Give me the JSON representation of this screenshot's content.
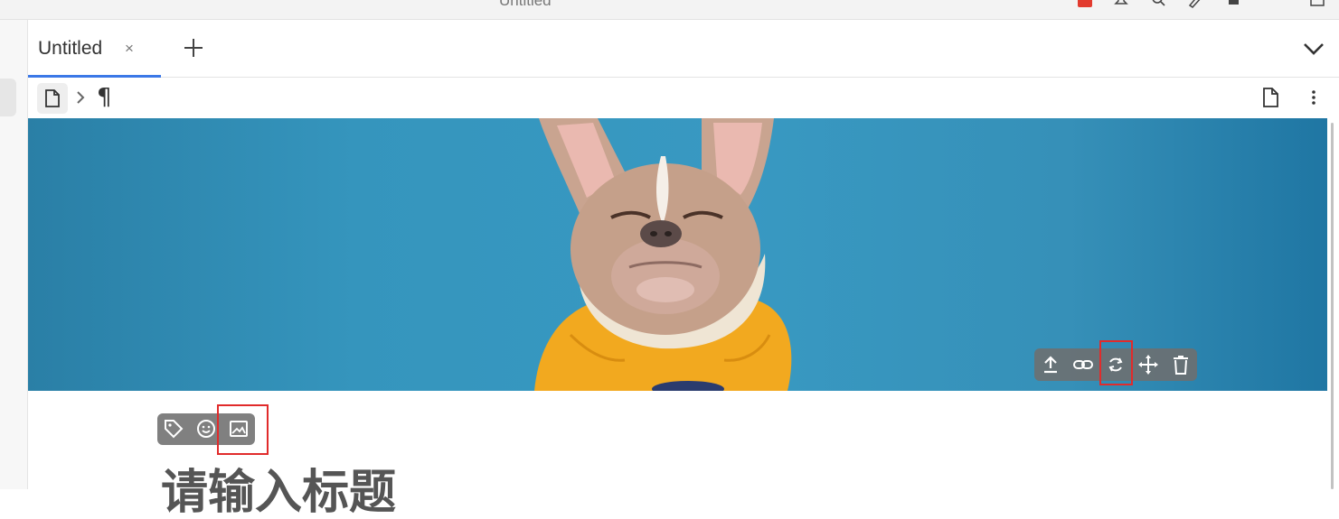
{
  "window": {
    "title": "Untitled"
  },
  "tabs": [
    {
      "label": "Untitled",
      "close": "×"
    }
  ],
  "breadcrumb": {
    "paragraph_symbol": "¶"
  },
  "cover": {
    "image": "cover-photo-french-bulldog-on-blue-background",
    "toolbar": [
      "upload-icon",
      "link-icon",
      "refresh-icon",
      "move-icon",
      "delete-icon"
    ]
  },
  "doc_toolbar": [
    "tag-icon",
    "emoji-icon",
    "image-icon"
  ],
  "editor": {
    "title_placeholder": "请输入标题"
  },
  "colors": {
    "accent": "#3b78e7",
    "highlight": "#e12b2b",
    "cover_bg": "#3899c2",
    "toolbar_bg": "#6e6e6e"
  }
}
